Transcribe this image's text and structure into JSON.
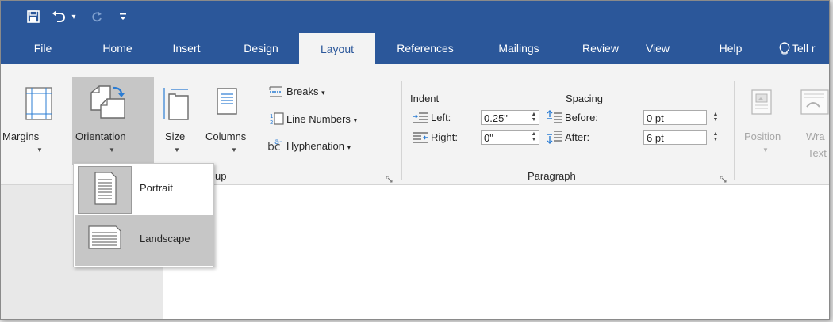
{
  "quick_access": {
    "save_icon": "save-icon",
    "undo_icon": "undo-icon",
    "undo_caret": "▾",
    "redo_icon": "redo-icon",
    "customize_icon": "customize-qat-icon"
  },
  "tabs": [
    {
      "label": "File"
    },
    {
      "label": "Home"
    },
    {
      "label": "Insert"
    },
    {
      "label": "Design"
    },
    {
      "label": "Layout"
    },
    {
      "label": "References"
    },
    {
      "label": "Mailings"
    },
    {
      "label": "Review"
    },
    {
      "label": "View"
    },
    {
      "label": "Help"
    },
    {
      "label": "Tell r"
    }
  ],
  "active_tab": "Layout",
  "page_setup": {
    "margins": "Margins",
    "orientation": "Orientation",
    "size": "Size",
    "columns": "Columns",
    "breaks": "Breaks",
    "line_numbers": "Line Numbers",
    "hyphenation": "Hyphenation",
    "group_label": "up"
  },
  "paragraph": {
    "indent_heading": "Indent",
    "spacing_heading": "Spacing",
    "left_label": "Left:",
    "left_value": "0.25\"",
    "right_label": "Right:",
    "right_value": "0\"",
    "before_label": "Before:",
    "before_value": "0 pt",
    "after_label": "After:",
    "after_value": "6 pt",
    "group_label": "Paragraph"
  },
  "arrange": {
    "position": "Position",
    "wrap_line1": "Wra",
    "wrap_line2": "Text"
  },
  "orientation_menu": {
    "portrait": "Portrait",
    "landscape": "Landscape",
    "selected": "Portrait",
    "hovered": "Landscape"
  },
  "colors": {
    "accent": "#2b579a",
    "ribbon_bg": "#f3f3f3",
    "selected_bg": "#c6c6c6",
    "icon_blue": "#2b7cd3"
  }
}
